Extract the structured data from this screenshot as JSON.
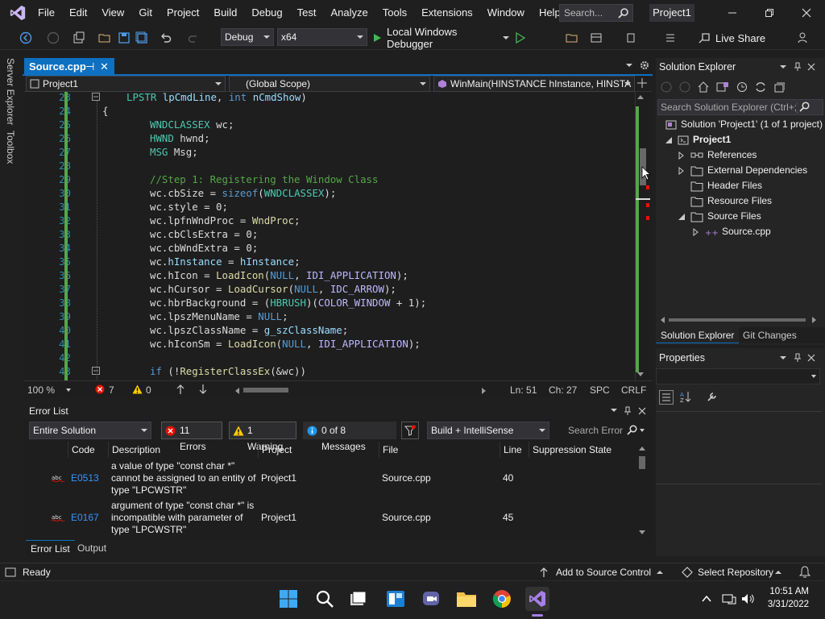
{
  "menu": [
    "File",
    "Edit",
    "View",
    "Git",
    "Project",
    "Build",
    "Debug",
    "Test",
    "Analyze",
    "Tools",
    "Extensions",
    "Window",
    "Help"
  ],
  "search": {
    "placeholder": "Search..."
  },
  "project_title": "Project1",
  "toolbar": {
    "config": "Debug",
    "platform": "x64",
    "debugger": "Local Windows Debugger",
    "live_share": "Live Share"
  },
  "side_tabs": [
    "Server Explorer",
    "Toolbox"
  ],
  "doc_tab": {
    "name": "Source.cpp",
    "pin": "⊣",
    "close": "✕"
  },
  "navbar": {
    "project": "Project1",
    "scope": "(Global Scope)",
    "member": "WinMain(HINSTANCE hInstance, HINSTA"
  },
  "code_lines": [
    {
      "n": "23",
      "html": "LPSTR lpCmdLine, int nCmdShow)"
    },
    {
      "n": "24",
      "html": "{"
    },
    {
      "n": "25",
      "html": "WNDCLASSEX wc;"
    },
    {
      "n": "26",
      "html": "HWND hwnd;"
    },
    {
      "n": "27",
      "html": "MSG Msg;"
    },
    {
      "n": "28",
      "html": ""
    },
    {
      "n": "29",
      "html": "//Step 1: Registering the Window Class"
    },
    {
      "n": "30",
      "html": "wc.cbSize = sizeof(WNDCLASSEX);"
    },
    {
      "n": "31",
      "html": "wc.style = 0;"
    },
    {
      "n": "32",
      "html": "wc.lpfnWndProc = WndProc;"
    },
    {
      "n": "33",
      "html": "wc.cbClsExtra = 0;"
    },
    {
      "n": "34",
      "html": "wc.cbWndExtra = 0;"
    },
    {
      "n": "35",
      "html": "wc.hInstance = hInstance;"
    },
    {
      "n": "36",
      "html": "wc.hIcon = LoadIcon(NULL, IDI_APPLICATION);"
    },
    {
      "n": "37",
      "html": "wc.hCursor = LoadCursor(NULL, IDC_ARROW);"
    },
    {
      "n": "38",
      "html": "wc.hbrBackground = (HBRUSH)(COLOR_WINDOW + 1);"
    },
    {
      "n": "39",
      "html": "wc.lpszMenuName = NULL;"
    },
    {
      "n": "40",
      "html": "wc.lpszClassName = g_szClassName;"
    },
    {
      "n": "41",
      "html": "wc.hIconSm = LoadIcon(NULL, IDI_APPLICATION);"
    },
    {
      "n": "42",
      "html": ""
    },
    {
      "n": "43",
      "html": "if (!RegisterClassEx(&wc))"
    }
  ],
  "editor_status": {
    "zoom": "100 %",
    "errors": "7",
    "warnings": "0",
    "ln": "Ln: 51",
    "ch": "Ch: 27",
    "spc": "SPC",
    "eol": "CRLF"
  },
  "error_list": {
    "title": "Error List",
    "scope": "Entire Solution",
    "errors_btn": "11 Errors",
    "warning_btn": "1 Warning",
    "messages_btn": "0 of 8 Messages",
    "build_filter": "Build + IntelliSense",
    "search_placeholder": "Search Error",
    "columns": [
      "Code",
      "Description",
      "Project",
      "File",
      "Line",
      "Suppression State"
    ],
    "rows": [
      {
        "code": "E0513",
        "desc": "a value of type \"const char *\" cannot be assigned to an entity of type \"LPCWSTR\"",
        "project": "Project1",
        "file": "Source.cpp",
        "line": "40"
      },
      {
        "code": "E0167",
        "desc": "argument of type \"const char *\" is incompatible with parameter of type \"LPCWSTR\"",
        "project": "Project1",
        "file": "Source.cpp",
        "line": "45"
      }
    ],
    "tabs": [
      "Error List",
      "Output"
    ]
  },
  "solution_explorer": {
    "title": "Solution Explorer",
    "search_placeholder": "Search Solution Explorer (Ctrl+;)",
    "items": [
      "Solution 'Project1' (1 of 1 project)",
      "Project1",
      "References",
      "External Dependencies",
      "Header Files",
      "Resource Files",
      "Source Files",
      "Source.cpp"
    ],
    "tabs": [
      "Solution Explorer",
      "Git Changes"
    ]
  },
  "properties": {
    "title": "Properties"
  },
  "statusbar": {
    "ready": "Ready",
    "source_control": "Add to Source Control",
    "repo": "Select Repository"
  },
  "clock": {
    "time": "10:51 AM",
    "date": "3/31/2022"
  },
  "colors": {
    "accent": "#0e70c0",
    "vs_purple": "#8661c5",
    "error_red": "#e51400",
    "warning_yellow": "#ffcc00"
  }
}
